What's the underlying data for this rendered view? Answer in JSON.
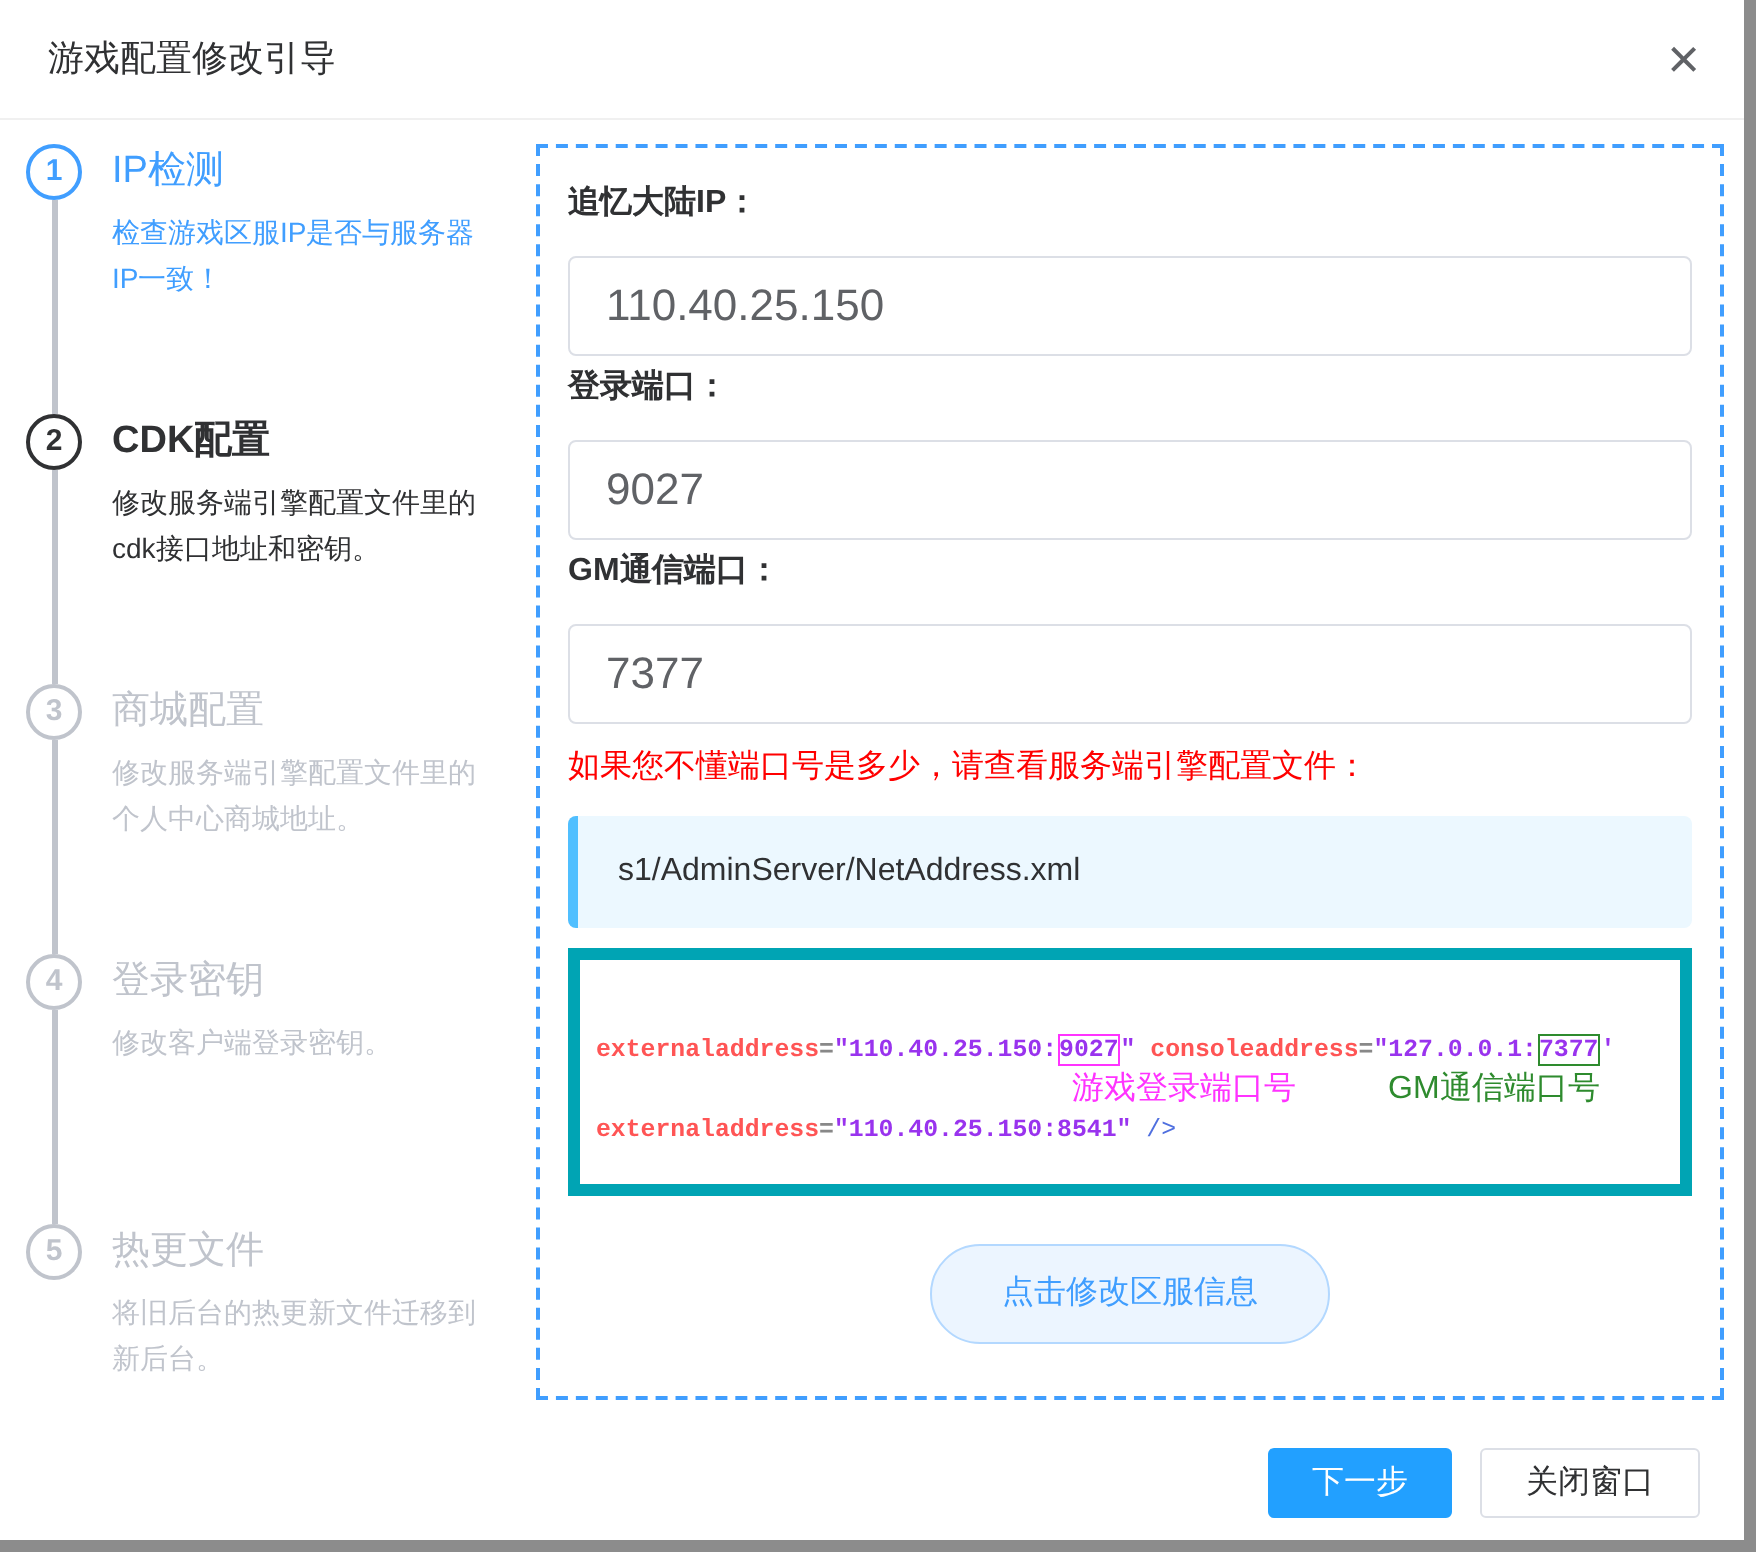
{
  "dialog": {
    "title": "游戏配置修改引导",
    "close": "×"
  },
  "steps": [
    {
      "number": "1",
      "title": "IP检测",
      "description": "检查游戏区服IP是否与服务器IP一致！",
      "kind": "finished"
    },
    {
      "number": "2",
      "title": "CDK配置",
      "description": "修改服务端引擎配置文件里的cdk接口地址和密钥。",
      "kind": "process"
    },
    {
      "number": "3",
      "title": "商城配置",
      "description": "修改服务端引擎配置文件里的个人中心商城地址。",
      "kind": "wait"
    },
    {
      "number": "4",
      "title": "登录密钥",
      "description": "修改客户端登录密钥。",
      "kind": "wait"
    },
    {
      "number": "5",
      "title": "热更文件",
      "description": "将旧后台的热更新文件迁移到新后台。",
      "kind": "wait"
    }
  ],
  "form": {
    "fields": [
      {
        "label": "追忆大陆IP：",
        "value": "110.40.25.150"
      },
      {
        "label": "登录端口：",
        "value": "9027"
      },
      {
        "label": "GM通信端口：",
        "value": "7377"
      }
    ],
    "note": "如果您不懂端口号是多少，请查看服务端引擎配置文件：",
    "file_path": "s1/AdminServer/NetAddress.xml",
    "snippet": {
      "lines": [
        [
          {
            "text": "externaladdress",
            "kind": "attr"
          },
          {
            "text": "=",
            "kind": "punct"
          },
          {
            "text": "\"110.40.25.150:",
            "kind": "value"
          },
          {
            "text": "9027",
            "kind": "boxed",
            "color": "#ff33ff"
          },
          {
            "text": "\"",
            "kind": "value"
          },
          {
            "text": " consoleaddress",
            "kind": "attr"
          },
          {
            "text": "=",
            "kind": "punct"
          },
          {
            "text": "\"127.0.0.1:",
            "kind": "value"
          },
          {
            "text": "7377",
            "kind": "boxed",
            "color": "#2e8b2e"
          },
          {
            "text": "'",
            "kind": "value"
          }
        ],
        [
          {
            "text": "externaladdress",
            "kind": "attr"
          },
          {
            "text": "=",
            "kind": "punct"
          },
          {
            "text": "\"110.40.25.150:8541\"",
            "kind": "value"
          },
          {
            "text": " />",
            "kind": "tag"
          }
        ]
      ],
      "callouts": [
        {
          "text": "游戏登录端口号",
          "color": "#ff33ff"
        },
        {
          "text": "GM通信端口号",
          "color": "#2e8b2e"
        }
      ]
    },
    "submit": "点击修改区服信息"
  },
  "footer": {
    "buttons": [
      {
        "label": "下一步",
        "kind": "primary"
      },
      {
        "label": "关闭窗口",
        "kind": "default"
      }
    ]
  }
}
